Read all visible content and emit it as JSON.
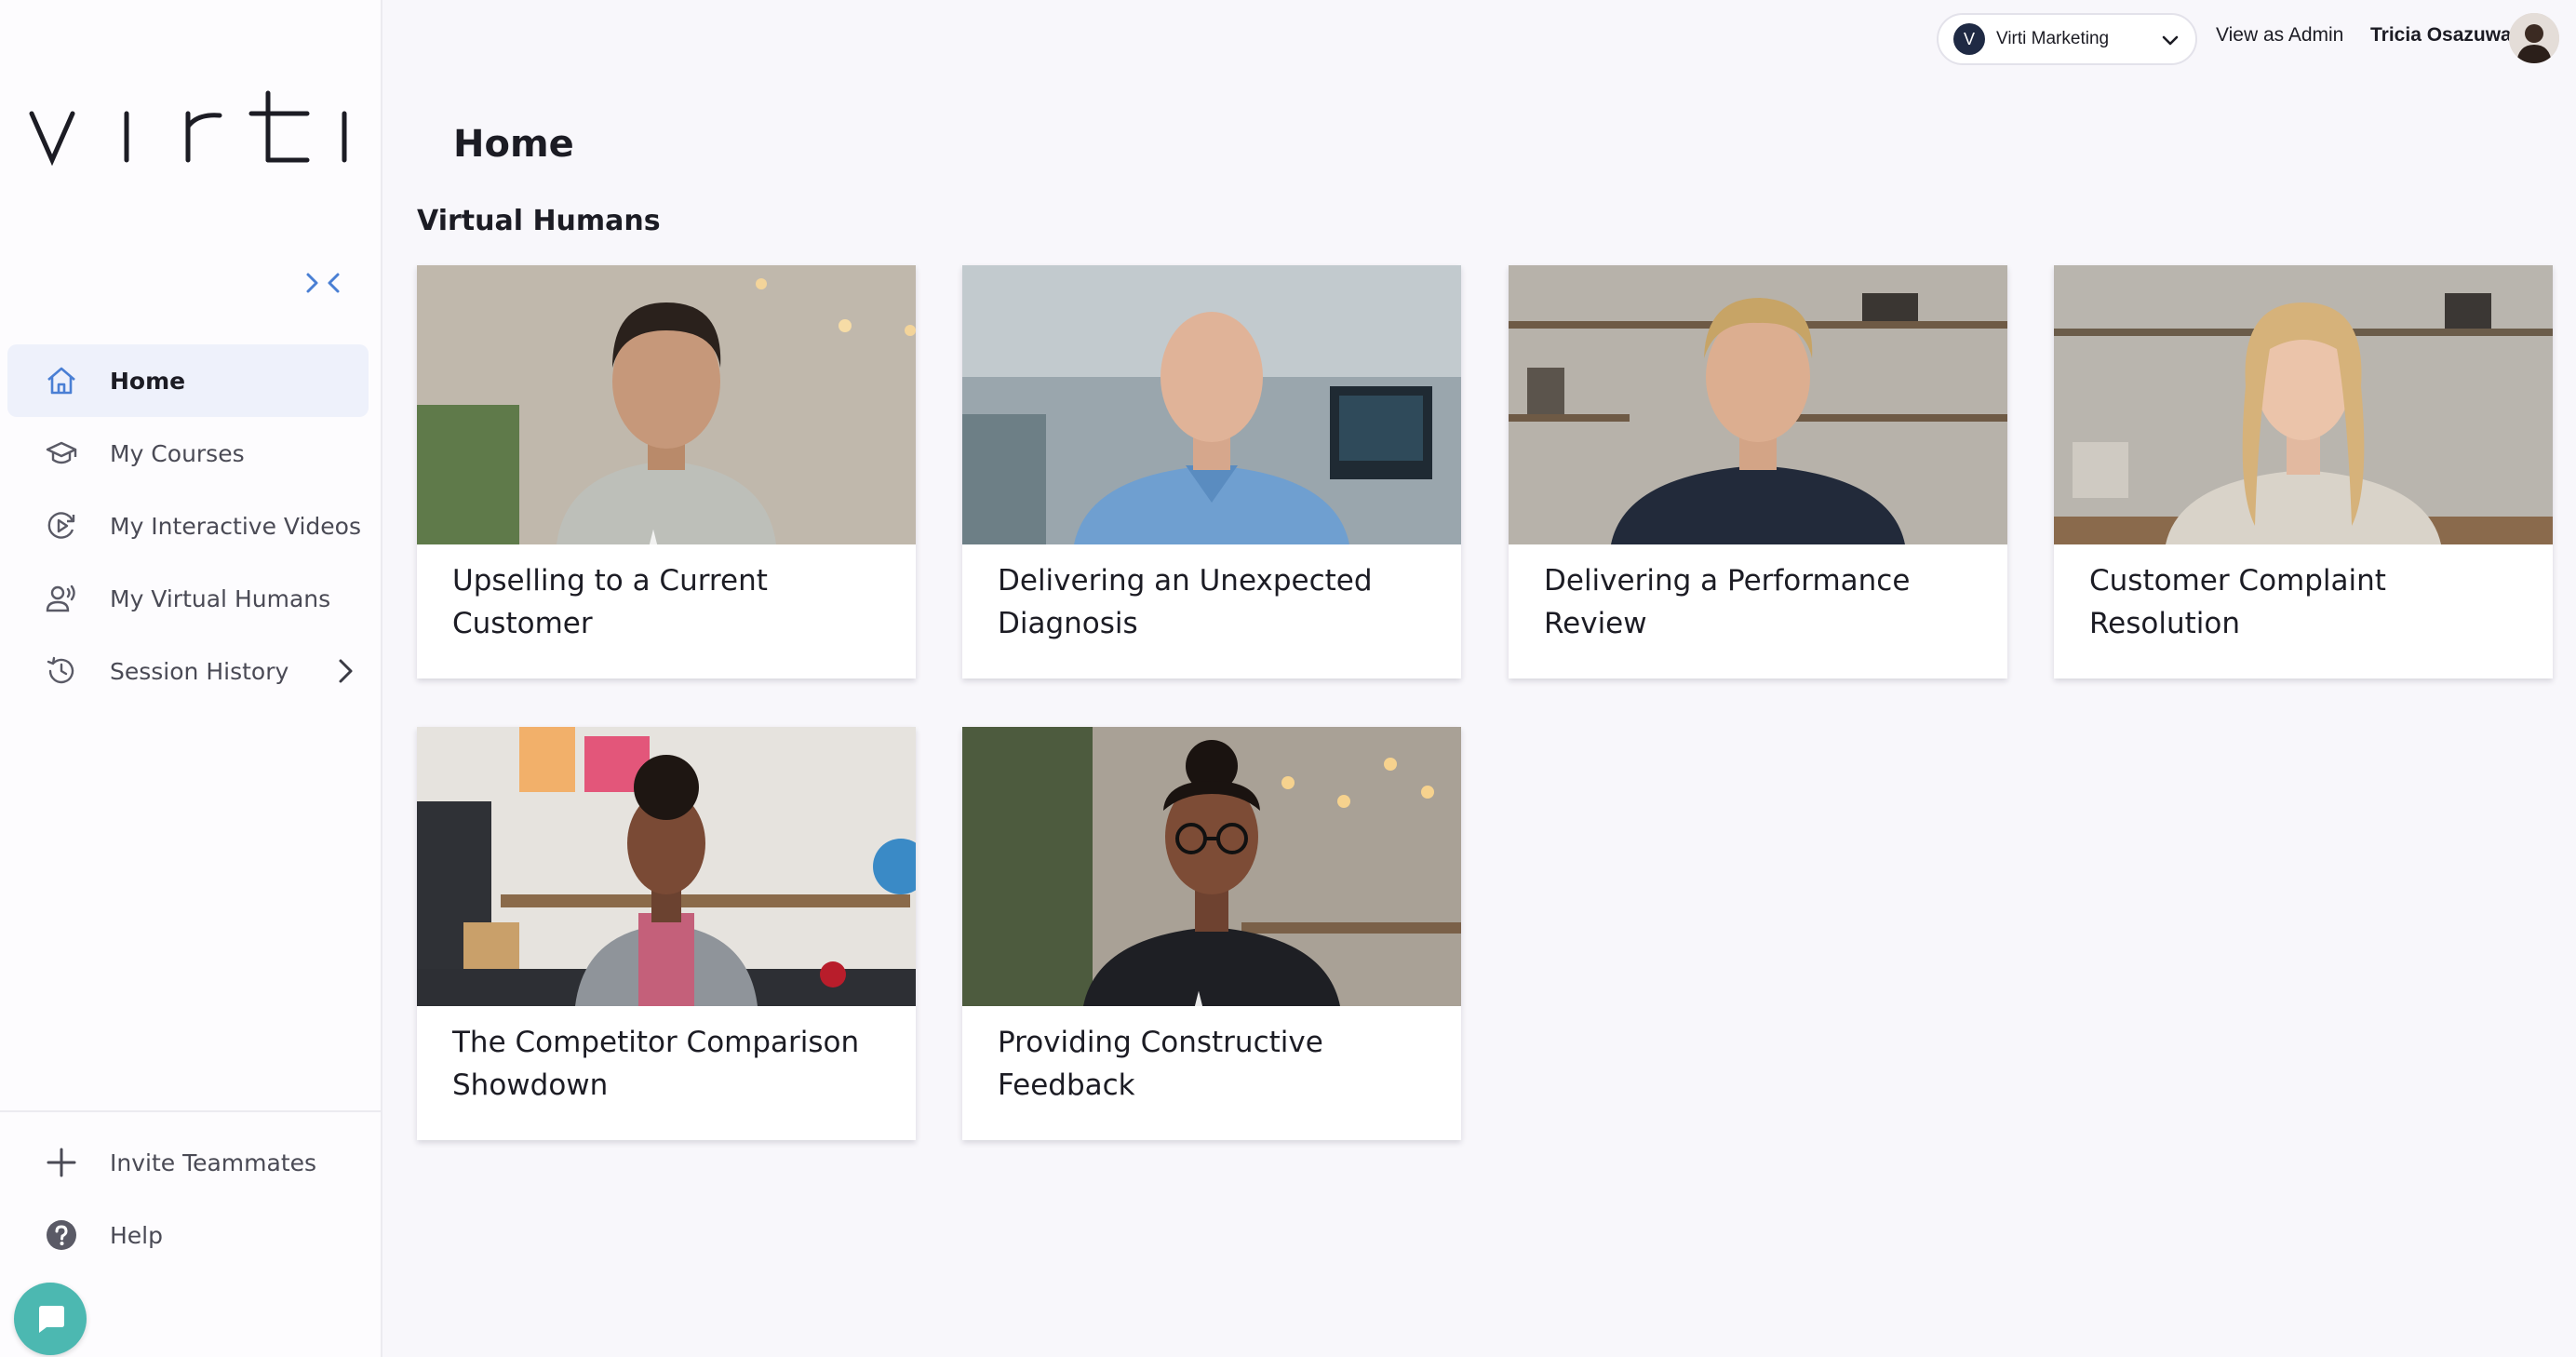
{
  "app": {
    "logo_text": "virti",
    "colors": {
      "accent": "#4a7fd4",
      "active_bg": "#eef1fb",
      "chat": "#4cb8b1"
    }
  },
  "sidebar": {
    "collapse_icon": "collapse-arrows-icon",
    "items": [
      {
        "label": "Home",
        "icon": "home-icon",
        "active": true
      },
      {
        "label": "My Courses",
        "icon": "graduation-cap-icon",
        "active": false
      },
      {
        "label": "My Interactive Videos",
        "icon": "play-circle-icon",
        "active": false
      },
      {
        "label": "My Virtual Humans",
        "icon": "speaking-person-icon",
        "active": false
      },
      {
        "label": "Session History",
        "icon": "history-icon",
        "active": false
      }
    ],
    "bottom_items": [
      {
        "label": "Invite Teammates",
        "icon": "plus-icon"
      },
      {
        "label": "Help",
        "icon": "help-icon"
      }
    ],
    "chat_icon": "chat-bubble-icon"
  },
  "header": {
    "org_select": {
      "badge": "V",
      "value": "Virti Marketing"
    },
    "view_as_admin": "View as Admin",
    "user_name": "Tricia Osazuwa"
  },
  "main": {
    "page_title": "Home",
    "section_title": "Virtual Humans",
    "cards": [
      {
        "title": "Upselling to a Current Customer"
      },
      {
        "title": "Delivering an Unexpected Diagnosis"
      },
      {
        "title": "Delivering a Performance Review"
      },
      {
        "title": "Customer Complaint Resolution"
      },
      {
        "title": "The Competitor Comparison Showdown"
      },
      {
        "title": "Providing Constructive Feedback"
      }
    ]
  }
}
